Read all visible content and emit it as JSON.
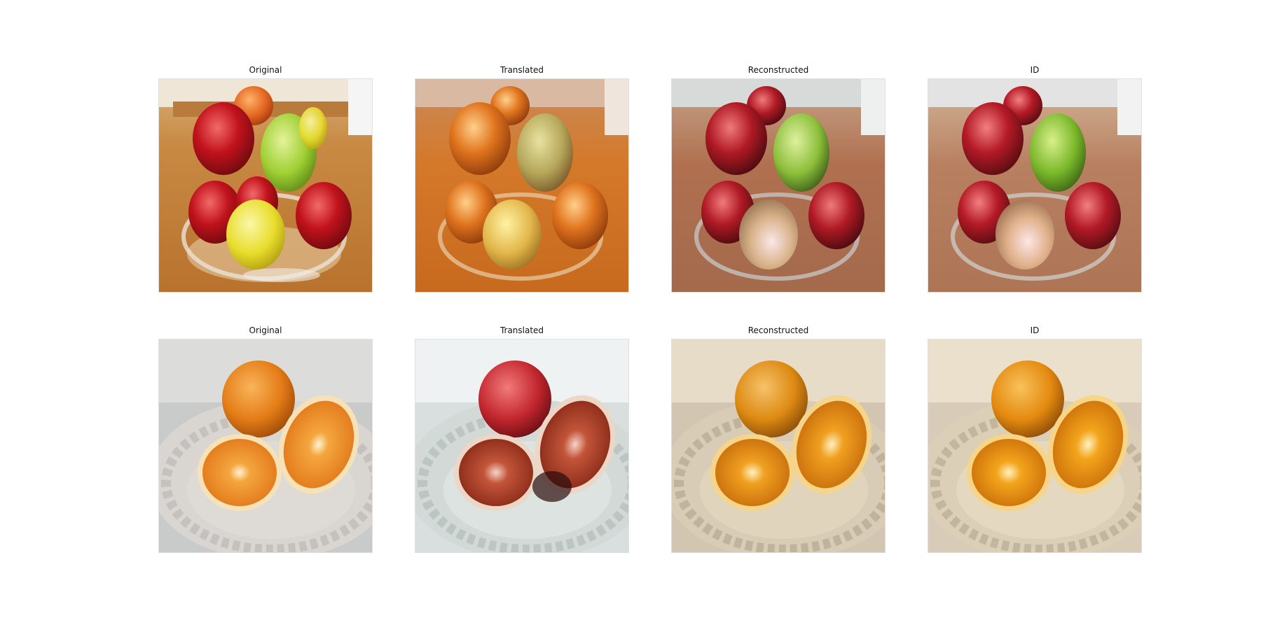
{
  "figure": {
    "rows": [
      {
        "subject": "apples",
        "panels": [
          {
            "title": "Original"
          },
          {
            "title": "Translated"
          },
          {
            "title": "Reconstructed"
          },
          {
            "title": "ID"
          }
        ]
      },
      {
        "subject": "oranges",
        "panels": [
          {
            "title": "Original"
          },
          {
            "title": "Translated"
          },
          {
            "title": "Reconstructed"
          },
          {
            "title": "ID"
          }
        ]
      }
    ]
  }
}
